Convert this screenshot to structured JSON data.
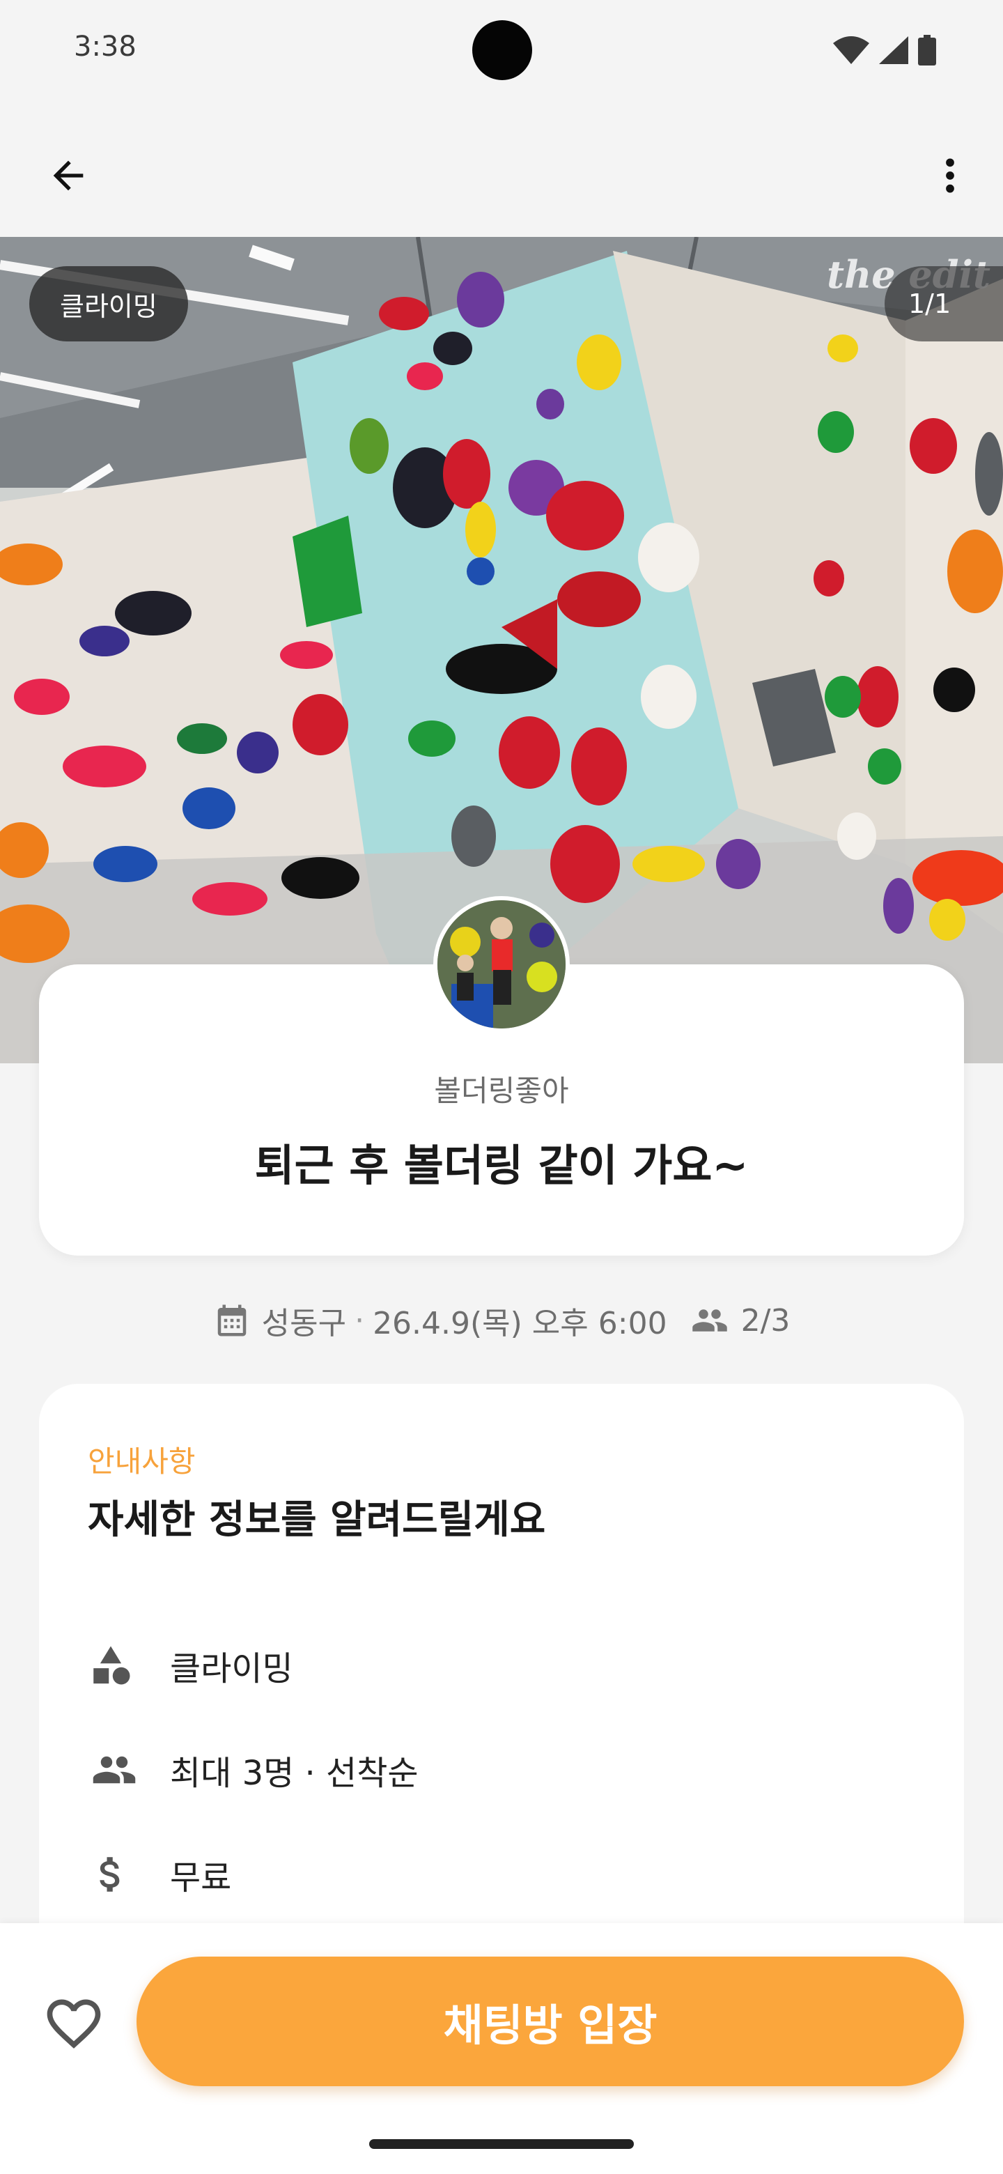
{
  "status_bar": {
    "time": "3:38",
    "icons": [
      "wifi-icon",
      "signal-icon",
      "battery-icon"
    ]
  },
  "app_bar": {
    "back_icon": "arrow-left-icon",
    "more_icon": "more-vert-icon"
  },
  "hero": {
    "category_tag": "클라이밍",
    "image_counter": "1/1",
    "watermark": "the edit"
  },
  "host": {
    "name": "볼더링좋아"
  },
  "post": {
    "title": "퇴근 후 볼더링 같이 가요~"
  },
  "meta": {
    "location": "성동구",
    "separator": "·",
    "datetime": "26.4.9(목) 오후 6:00",
    "participants": "2/3"
  },
  "info": {
    "kicker": "안내사항",
    "heading": "자세한 정보를 알려드릴게요",
    "rows": [
      {
        "icon": "category-icon",
        "text": "클라이밍"
      },
      {
        "icon": "people-icon",
        "text": "최대 3명 · 선착순"
      },
      {
        "icon": "dollar-icon",
        "text": "무료"
      }
    ]
  },
  "bottom": {
    "like_icon": "heart-outline-icon",
    "cta_label": "채팅방 입장"
  },
  "colors": {
    "accent": "#fba63c",
    "kicker": "#f7a23b",
    "background": "#f4f4f4"
  }
}
